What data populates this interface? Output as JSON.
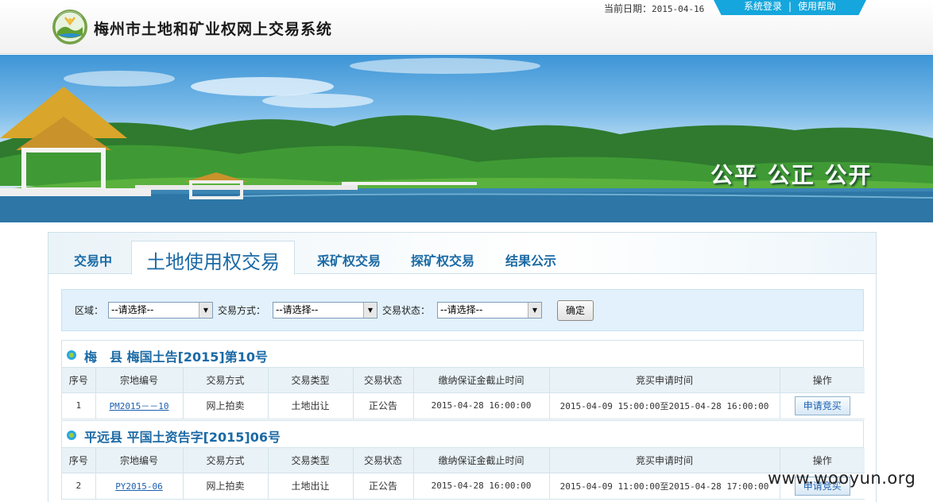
{
  "header": {
    "site_title": "梅州市土地和矿业权网上交易系统",
    "date_label": "当前日期：",
    "date_value": "2015-04-16",
    "login_link": "系统登录",
    "divider": "|",
    "help_link": "使用帮助"
  },
  "banner": {
    "slogan": "公平 公正 公开"
  },
  "tabs": [
    {
      "label": "交易中"
    },
    {
      "label": "土地使用权交易"
    },
    {
      "label": "采矿权交易"
    },
    {
      "label": "探矿权交易"
    },
    {
      "label": "结果公示"
    }
  ],
  "filter": {
    "region_label": "区域：",
    "region_value": "--请选择--",
    "method_label": "交易方式：",
    "method_value": "--请选择--",
    "status_label": "交易状态：",
    "status_value": "--请选择--",
    "confirm_button": "确定"
  },
  "table_headers": [
    "序号",
    "宗地编号",
    "交易方式",
    "交易类型",
    "交易状态",
    "缴纳保证金截止时间",
    "竞买申请时间",
    "操作"
  ],
  "listings": [
    {
      "title": "梅　县 梅国土告[2015]第10号",
      "row": {
        "index": "1",
        "parcel_id": "PM2015－－10",
        "method": "网上拍卖",
        "type": "土地出让",
        "status": "正公告",
        "deposit_deadline": "2015-04-28 16:00:00",
        "application_period": "2015-04-09 15:00:00至2015-04-28 16:00:00",
        "action": "申请竞买"
      }
    },
    {
      "title": "平远县 平国土资告字[2015]06号",
      "row": {
        "index": "2",
        "parcel_id": "PY2015-06",
        "method": "网上拍卖",
        "type": "土地出让",
        "status": "正公告",
        "deposit_deadline": "2015-04-28 16:00:00",
        "application_period": "2015-04-09 11:00:00至2015-04-28 17:00:00",
        "action": "申请竞买"
      }
    }
  ],
  "watermark": "www.wooyun.org"
}
